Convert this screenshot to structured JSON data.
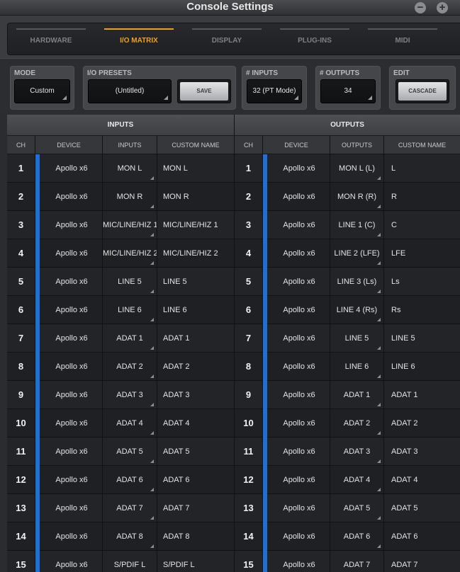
{
  "window": {
    "title": "Console Settings",
    "minimize_glyph": "−",
    "zoom_glyph": "+"
  },
  "tabs": [
    {
      "label": "HARDWARE",
      "active": false
    },
    {
      "label": "I/O MATRIX",
      "active": true
    },
    {
      "label": "DISPLAY",
      "active": false
    },
    {
      "label": "PLUG-INS",
      "active": false
    },
    {
      "label": "MIDI",
      "active": false
    }
  ],
  "controls": {
    "mode": {
      "label": "MODE",
      "value": "Custom"
    },
    "io_presets": {
      "label": "I/O PRESETS",
      "value": "(Untitled)",
      "save_label": "SAVE"
    },
    "num_inputs": {
      "label": "# INPUTS",
      "value": "32 (PT Mode)"
    },
    "num_outputs": {
      "label": "# OUTPUTS",
      "value": "34"
    },
    "edit": {
      "label": "EDIT",
      "cascade_label": "CASCADE"
    }
  },
  "matrix": {
    "inputs_header": "INPUTS",
    "outputs_header": "OUTPUTS",
    "input_columns": [
      "CH",
      "DEVICE",
      "INPUTS",
      "CUSTOM NAME"
    ],
    "output_columns": [
      "CH",
      "DEVICE",
      "OUTPUTS",
      "CUSTOM NAME"
    ],
    "accent_color": "#1f6fd6",
    "rows": [
      {
        "ch": "1",
        "in_device": "Apollo x6",
        "in_input": "MON L",
        "in_name": "MON L",
        "out_ch": "1",
        "out_device": "Apollo x6",
        "out_output": "MON L (L)",
        "out_name": "L"
      },
      {
        "ch": "2",
        "in_device": "Apollo x6",
        "in_input": "MON R",
        "in_name": "MON R",
        "out_ch": "2",
        "out_device": "Apollo x6",
        "out_output": "MON R (R)",
        "out_name": "R"
      },
      {
        "ch": "3",
        "in_device": "Apollo x6",
        "in_input": "MIC/LINE/HIZ 1",
        "in_name": "MIC/LINE/HIZ 1",
        "out_ch": "3",
        "out_device": "Apollo x6",
        "out_output": "LINE 1 (C)",
        "out_name": "C"
      },
      {
        "ch": "4",
        "in_device": "Apollo x6",
        "in_input": "MIC/LINE/HIZ 2",
        "in_name": "MIC/LINE/HIZ 2",
        "out_ch": "4",
        "out_device": "Apollo x6",
        "out_output": "LINE 2 (LFE)",
        "out_name": "LFE"
      },
      {
        "ch": "5",
        "in_device": "Apollo x6",
        "in_input": "LINE 5",
        "in_name": "LINE 5",
        "out_ch": "5",
        "out_device": "Apollo x6",
        "out_output": "LINE 3 (Ls)",
        "out_name": "Ls"
      },
      {
        "ch": "6",
        "in_device": "Apollo x6",
        "in_input": "LINE 6",
        "in_name": "LINE 6",
        "out_ch": "6",
        "out_device": "Apollo x6",
        "out_output": "LINE 4 (Rs)",
        "out_name": "Rs"
      },
      {
        "ch": "7",
        "in_device": "Apollo x6",
        "in_input": "ADAT 1",
        "in_name": "ADAT 1",
        "out_ch": "7",
        "out_device": "Apollo x6",
        "out_output": "LINE 5",
        "out_name": "LINE 5"
      },
      {
        "ch": "8",
        "in_device": "Apollo x6",
        "in_input": "ADAT 2",
        "in_name": "ADAT 2",
        "out_ch": "8",
        "out_device": "Apollo x6",
        "out_output": "LINE 6",
        "out_name": "LINE 6"
      },
      {
        "ch": "9",
        "in_device": "Apollo x6",
        "in_input": "ADAT 3",
        "in_name": "ADAT 3",
        "out_ch": "9",
        "out_device": "Apollo x6",
        "out_output": "ADAT 1",
        "out_name": "ADAT 1"
      },
      {
        "ch": "10",
        "in_device": "Apollo x6",
        "in_input": "ADAT 4",
        "in_name": "ADAT 4",
        "out_ch": "10",
        "out_device": "Apollo x6",
        "out_output": "ADAT 2",
        "out_name": "ADAT 2"
      },
      {
        "ch": "11",
        "in_device": "Apollo x6",
        "in_input": "ADAT 5",
        "in_name": "ADAT 5",
        "out_ch": "11",
        "out_device": "Apollo x6",
        "out_output": "ADAT 3",
        "out_name": "ADAT 3"
      },
      {
        "ch": "12",
        "in_device": "Apollo x6",
        "in_input": "ADAT 6",
        "in_name": "ADAT 6",
        "out_ch": "12",
        "out_device": "Apollo x6",
        "out_output": "ADAT 4",
        "out_name": "ADAT 4"
      },
      {
        "ch": "13",
        "in_device": "Apollo x6",
        "in_input": "ADAT 7",
        "in_name": "ADAT 7",
        "out_ch": "13",
        "out_device": "Apollo x6",
        "out_output": "ADAT 5",
        "out_name": "ADAT 5"
      },
      {
        "ch": "14",
        "in_device": "Apollo x6",
        "in_input": "ADAT 8",
        "in_name": "ADAT 8",
        "out_ch": "14",
        "out_device": "Apollo x6",
        "out_output": "ADAT 6",
        "out_name": "ADAT 6"
      },
      {
        "ch": "15",
        "in_device": "Apollo x6",
        "in_input": "S/PDIF L",
        "in_name": "S/PDIF L",
        "out_ch": "15",
        "out_device": "Apollo x6",
        "out_output": "ADAT 7",
        "out_name": "ADAT 7"
      }
    ]
  }
}
